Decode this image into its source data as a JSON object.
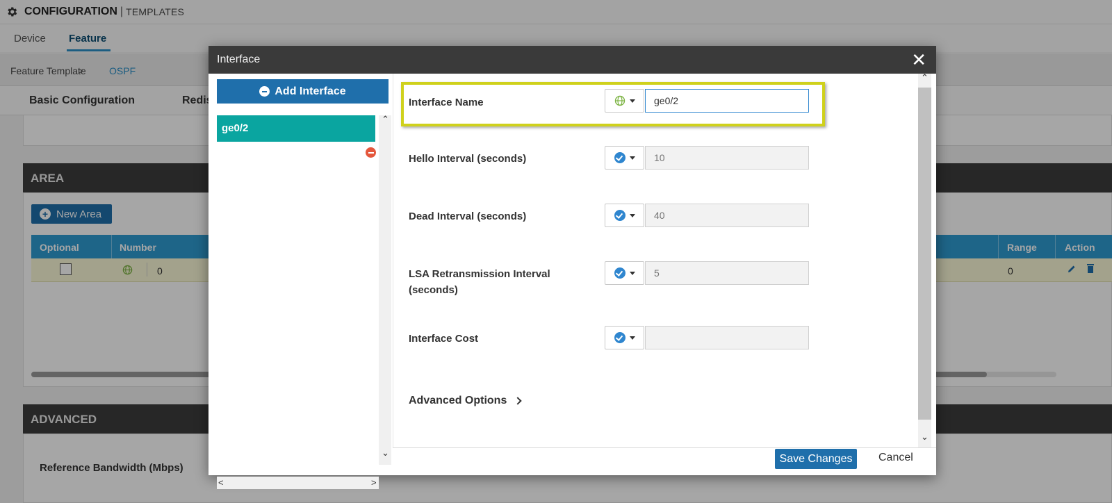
{
  "background": {
    "header": {
      "title": "CONFIGURATION",
      "separator": "|",
      "subtitle": "TEMPLATES"
    },
    "tabs": [
      {
        "label": "Device"
      },
      {
        "label": "Feature"
      }
    ],
    "breadcrumb": {
      "root": "Feature Template",
      "separator": ">",
      "current": "OSPF"
    },
    "subtabs": [
      {
        "label": "Basic Configuration"
      },
      {
        "label": "Redis"
      }
    ],
    "area": {
      "title": "AREA",
      "new_button": "New Area",
      "columns": {
        "optional": "Optional",
        "number": "Number",
        "range": "Range",
        "action": "Action"
      },
      "row": {
        "number": "0",
        "range": "0"
      }
    },
    "advanced": {
      "title": "ADVANCED",
      "reference_bandwidth": "Reference Bandwidth (Mbps)"
    }
  },
  "modal": {
    "title": "Interface",
    "close_symbol": "✕",
    "add_button": "Add Interface",
    "interfaces": [
      {
        "name": "ge0/2"
      }
    ],
    "fields": {
      "interface_name": {
        "label": "Interface Name",
        "value": "ge0/2",
        "scope_icon": "globe-icon"
      },
      "hello": {
        "label": "Hello Interval (seconds)",
        "placeholder": "10",
        "scope_icon": "check-circle-icon"
      },
      "dead": {
        "label": "Dead Interval (seconds)",
        "placeholder": "40",
        "scope_icon": "check-circle-icon"
      },
      "lsa": {
        "label_line1": "LSA Retransmission Interval",
        "label_line2": "(seconds)",
        "placeholder": "5",
        "scope_icon": "check-circle-icon"
      },
      "cost": {
        "label": "Interface Cost",
        "placeholder": "",
        "scope_icon": "check-circle-icon"
      }
    },
    "advanced_options": "Advanced Options",
    "save": "Save Changes",
    "cancel": "Cancel",
    "scroll_arrows": {
      "up": "⌃",
      "down": "⌄",
      "left": "<",
      "right": ">"
    }
  },
  "colors": {
    "primary": "#1f6fab",
    "teal_selected": "#0aa5a0",
    "highlight": "#cfd11c",
    "table_header": "#2e9bd1",
    "dark_header": "#3a3a3a",
    "remove": "#e4573c"
  }
}
